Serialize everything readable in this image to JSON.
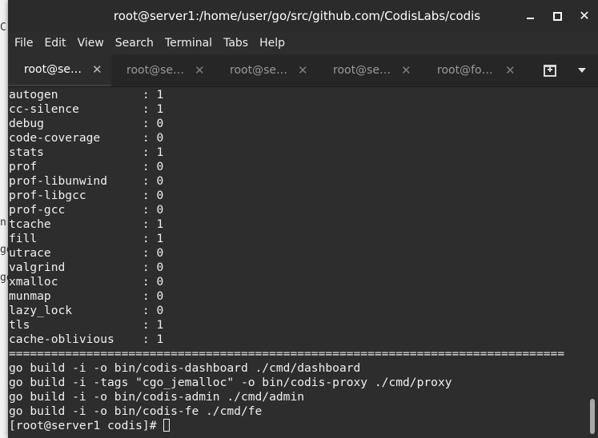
{
  "window": {
    "title": "root@server1:/home/user/go/src/github.com/CodisLabs/codis",
    "controls": {
      "minimize_icon": "minimize-icon",
      "maximize_icon": "maximize-icon",
      "close_icon": "close-icon"
    }
  },
  "background_fragments": [
    "C",
    "n",
    "go",
    "go"
  ],
  "menubar": {
    "items": [
      "File",
      "Edit",
      "View",
      "Search",
      "Terminal",
      "Tabs",
      "Help"
    ]
  },
  "tabs": [
    {
      "label": "root@se…",
      "active": true
    },
    {
      "label": "root@se…",
      "active": false
    },
    {
      "label": "root@se…",
      "active": false
    },
    {
      "label": "root@se…",
      "active": false
    },
    {
      "label": "root@fo…",
      "active": false
    }
  ],
  "tab_close_glyph": "✕",
  "terminal": {
    "lines": [
      "autogen            : 1",
      "cc-silence         : 1",
      "debug              : 0",
      "code-coverage      : 0",
      "stats              : 1",
      "prof               : 0",
      "prof-libunwind     : 0",
      "prof-libgcc        : 0",
      "prof-gcc           : 0",
      "tcache             : 1",
      "fill               : 1",
      "utrace             : 0",
      "valgrind           : 0",
      "xmalloc            : 0",
      "munmap             : 0",
      "lazy_lock          : 0",
      "tls                : 1",
      "cache-oblivious    : 1",
      "===============================================================================",
      "go build -i -o bin/codis-dashboard ./cmd/dashboard",
      "go build -i -tags \"cgo_jemalloc\" -o bin/codis-proxy ./cmd/proxy",
      "go build -i -o bin/codis-admin ./cmd/admin",
      "go build -i -o bin/codis-fe ./cmd/fe"
    ],
    "prompt": "[root@server1 codis]# "
  },
  "colors": {
    "terminal_bg": "#2d2d2d",
    "terminal_fg": "#f0f0f0",
    "titlebar_bg": "#2b2b2b",
    "tabbar_bg": "#262626"
  }
}
